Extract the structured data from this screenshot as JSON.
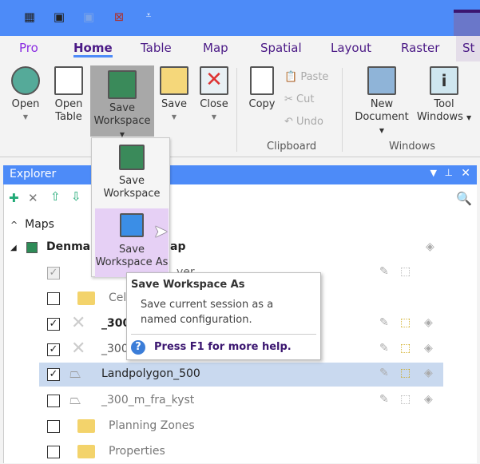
{
  "quick_access": {
    "icons": [
      "open-table-icon",
      "save-workspace-icon",
      "save-icon-disabled",
      "close-table-icon",
      "customize-icon"
    ],
    "customize": "⩡"
  },
  "tabs": [
    "Pro",
    "Home",
    "Table",
    "Map",
    "Spatial",
    "Layout",
    "Raster",
    "St"
  ],
  "ribbon": {
    "open": "Open",
    "open_table_1": "Open",
    "open_table_2": "Table",
    "save_ws_1": "Save",
    "save_ws_2": "Workspace",
    "save": "Save",
    "close": "Close",
    "copy": "Copy",
    "paste": "Paste",
    "cut": "Cut",
    "undo": "Undo",
    "clipboard": "Clipboard",
    "new_doc_1": "New",
    "new_doc_2": "Document",
    "tool_win_1": "Tool",
    "tool_win_2": "Windows",
    "windows": "Windows"
  },
  "explorer": {
    "title": "Explorer",
    "maps": "Maps",
    "map_name_a": "Denmar",
    "map_name_b": "ap",
    "rows": [
      {
        "label": "ver",
        "checked": true
      },
      {
        "label": "Cel",
        "checked": false
      },
      {
        "label": "_300",
        "checked": true
      },
      {
        "label": "_300",
        "checked": true
      },
      {
        "label": "Landpolygon_500",
        "checked": true
      },
      {
        "label": "_300_m_fra_kyst",
        "checked": false
      },
      {
        "label": "Planning Zones",
        "checked": false
      },
      {
        "label": "Properties",
        "checked": false
      }
    ]
  },
  "menu": {
    "save_ws_1": "Save",
    "save_ws_2": "Workspace",
    "save_as_1": "Save",
    "save_as_2": "Workspace As"
  },
  "tooltip": {
    "title": "Save Workspace As",
    "body": "Save current session as a named configuration.",
    "help": "Press F1 for more help."
  },
  "colors": {
    "accent": "#4d8bf8",
    "tab_text": "#4b1a86",
    "selected_row": "#c9d9ef",
    "hover": "#e6d0f5"
  }
}
